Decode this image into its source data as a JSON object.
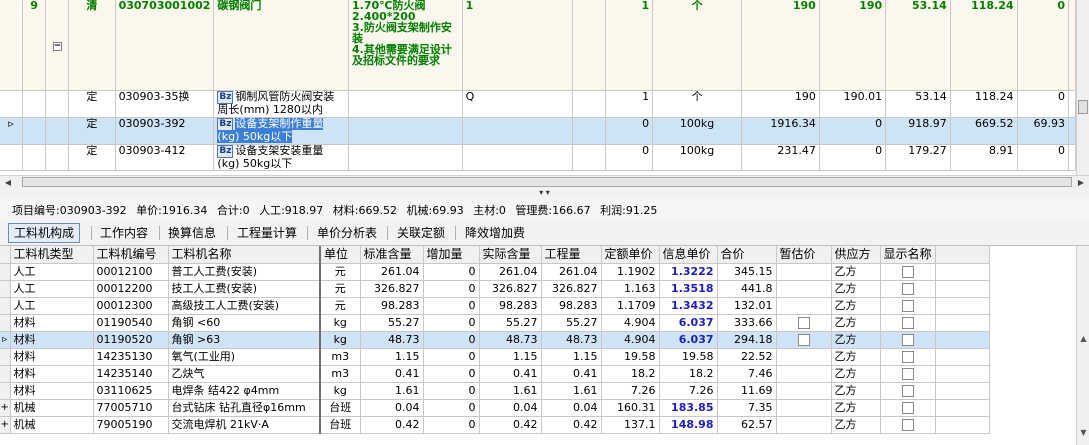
{
  "upper_rows": [
    {
      "seq": "9",
      "type": "清",
      "code": "030703001002",
      "name": "碳钢阀门",
      "feature": "1.70℃防火阀\n2.400*200\n3.防火阀支架制作安装\n4.其他需要满足设计及招标文件的要求",
      "c6": "1",
      "qty": "1",
      "unit": "个",
      "v1": "190",
      "v2": "190",
      "v3": "53.14",
      "v4": "118.24",
      "v5": "0",
      "v6": ""
    },
    {
      "type": "定",
      "code": "030903-35换",
      "name": "钢制风管防火阀安装周长(mm) 1280以内",
      "feature": "",
      "c6": "Q",
      "qty": "1",
      "unit": "个",
      "v1": "190",
      "v2": "190.01",
      "v3": "53.14",
      "v4": "118.24",
      "v5": "0",
      "v6": ""
    },
    {
      "type": "定",
      "code": "030903-392",
      "name": "设备支架制作重量(kg) 50kg以下",
      "feature": "",
      "c6": "",
      "qty": "0",
      "unit": "100kg",
      "v1": "1916.34",
      "v2": "0",
      "v3": "918.97",
      "v4": "669.52",
      "v5": "69.93",
      "v6": ""
    },
    {
      "type": "定",
      "code": "030903-412",
      "name": "设备支架安装重量(kg) 50kg以下",
      "feature": "",
      "c6": "",
      "qty": "0",
      "unit": "100kg",
      "v1": "231.47",
      "v2": "0",
      "v3": "179.27",
      "v4": "8.91",
      "v5": "0",
      "v6": ""
    }
  ],
  "bz_label": "Bz",
  "info": {
    "item_code": "项目编号:030903-392",
    "unit_price": "单价:1916.34",
    "total": "合计:0",
    "labor": "人工:918.97",
    "material": "材料:669.52",
    "machine": "机械:69.93",
    "main_material": "主材:0",
    "management": "管理费:166.67",
    "profit": "利润:91.25"
  },
  "tabs": [
    "工料机构成",
    "工作内容",
    "换算信息",
    "工程量计算",
    "单价分析表",
    "关联定额",
    "降效增加费"
  ],
  "columns": [
    "工料机类型",
    "工料机编号",
    "工料机名称",
    "单位",
    "标准含量",
    "增加量",
    "实际含量",
    "工程量",
    "定额单价",
    "信息单价",
    "合价",
    "暂估价",
    "供应方",
    "显示名称"
  ],
  "rows": [
    {
      "type": "人工",
      "code": "00012100",
      "name": "普工人工费(安装)",
      "unit": "元",
      "std": "261.04",
      "add": "0",
      "act": "261.04",
      "qty": "261.04",
      "dprice": "1.1902",
      "iprice": "1.3222",
      "total": "345.15",
      "est": false,
      "supplier": "乙方",
      "lead": ""
    },
    {
      "type": "人工",
      "code": "00012200",
      "name": "技工人工费(安装)",
      "unit": "元",
      "std": "326.827",
      "add": "0",
      "act": "326.827",
      "qty": "326.827",
      "dprice": "1.163",
      "iprice": "1.3518",
      "total": "441.8",
      "est": false,
      "supplier": "乙方",
      "lead": ""
    },
    {
      "type": "人工",
      "code": "00012300",
      "name": "高级技工人工费(安装)",
      "unit": "元",
      "std": "98.283",
      "add": "0",
      "act": "98.283",
      "qty": "98.283",
      "dprice": "1.1709",
      "iprice": "1.3432",
      "total": "132.01",
      "est": false,
      "supplier": "乙方",
      "lead": ""
    },
    {
      "type": "材料",
      "code": "01190540",
      "name": "角钢 <60",
      "unit": "kg",
      "std": "55.27",
      "add": "0",
      "act": "55.27",
      "qty": "55.27",
      "dprice": "4.904",
      "iprice": "6.037",
      "total": "333.66",
      "est": true,
      "supplier": "乙方",
      "lead": ""
    },
    {
      "type": "材料",
      "code": "01190520",
      "name": "角钢 >63",
      "unit": "kg",
      "std": "48.73",
      "add": "0",
      "act": "48.73",
      "qty": "48.73",
      "dprice": "4.904",
      "iprice": "6.037",
      "total": "294.18",
      "est": true,
      "supplier": "乙方",
      "lead": "▹"
    },
    {
      "type": "材料",
      "code": "14235130",
      "name": "氧气(工业用)",
      "unit": "m3",
      "std": "1.15",
      "add": "0",
      "act": "1.15",
      "qty": "1.15",
      "dprice": "19.58",
      "iprice": "19.58",
      "total": "22.52",
      "est": false,
      "supplier": "乙方",
      "lead": ""
    },
    {
      "type": "材料",
      "code": "14235140",
      "name": "乙炔气",
      "unit": "m3",
      "std": "0.41",
      "add": "0",
      "act": "0.41",
      "qty": "0.41",
      "dprice": "18.2",
      "iprice": "18.2",
      "total": "7.46",
      "est": false,
      "supplier": "乙方",
      "lead": ""
    },
    {
      "type": "材料",
      "code": "03110625",
      "name": "电焊条 结422 φ4mm",
      "unit": "kg",
      "std": "1.61",
      "add": "0",
      "act": "1.61",
      "qty": "1.61",
      "dprice": "7.26",
      "iprice": "7.26",
      "total": "11.69",
      "est": false,
      "supplier": "乙方",
      "lead": ""
    },
    {
      "type": "机械",
      "code": "77005710",
      "name": "台式钻床 钻孔直径φ16mm",
      "unit": "台班",
      "std": "0.04",
      "add": "0",
      "act": "0.04",
      "qty": "0.04",
      "dprice": "160.31",
      "iprice": "183.85",
      "total": "7.35",
      "est": false,
      "supplier": "乙方",
      "lead": "+"
    },
    {
      "type": "机械",
      "code": "79005190",
      "name": "交流电焊机 21kV·A",
      "unit": "台班",
      "std": "0.42",
      "add": "0",
      "act": "0.42",
      "qty": "0.42",
      "dprice": "137.1",
      "iprice": "148.98",
      "total": "62.57",
      "est": false,
      "supplier": "乙方",
      "lead": "+"
    }
  ],
  "blue_iprice_rows": [
    0,
    1,
    2,
    3,
    4,
    8,
    9
  ],
  "colors": {
    "selection": "#cfe3f7",
    "highlight": "#3d7fd8",
    "blue_value": "#1b1bd0",
    "green_text": "#008000"
  }
}
